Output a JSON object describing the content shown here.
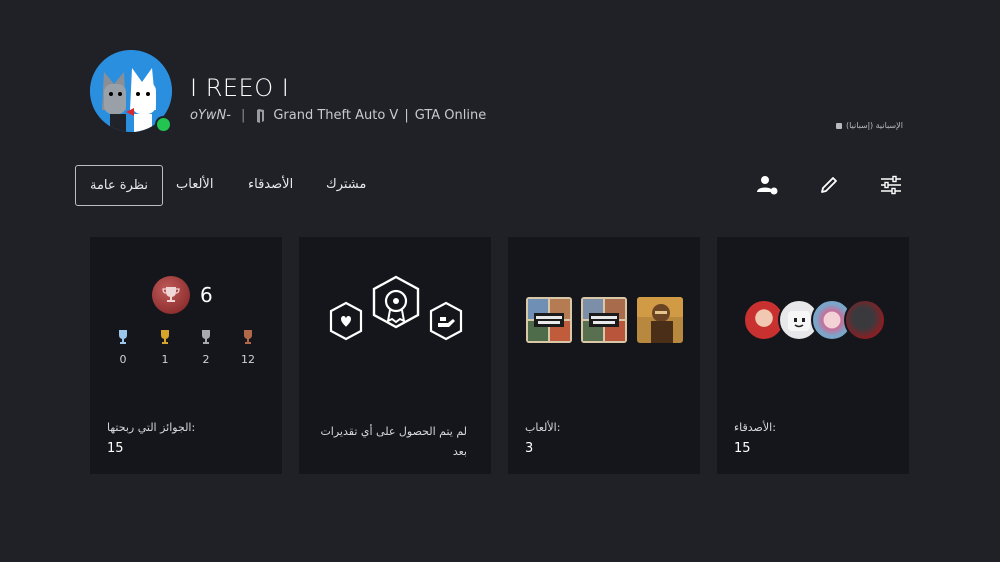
{
  "profile": {
    "name": "I REEO I",
    "online_id": "oYwN-",
    "separator": "|",
    "activity": "Grand Theft Auto V",
    "activity_separator": "|",
    "activity_detail": "GTA Online",
    "language": "الإسبانية (إسبانيا)",
    "online_status_color": "#23c552"
  },
  "tabs": {
    "overview": "نظرة عامة",
    "games": "الألعاب",
    "friends": "الأصدقاء",
    "subscriptions": "مشترك"
  },
  "toolbar": {
    "icons": [
      "add-friend-icon",
      "edit-icon",
      "settings-sliders-icon"
    ]
  },
  "cards": {
    "trophies": {
      "level": "6",
      "platinum": "0",
      "gold": "1",
      "silver": "2",
      "bronze": "12",
      "label": "الجوائز التي ربحتها:",
      "value": "15"
    },
    "awards": {
      "label": "لم يتم الحصول على أي تقديرات بعد"
    },
    "games": {
      "label": "الألعاب:",
      "value": "3"
    },
    "friends": {
      "label": "الأصدقاء:",
      "value": "15"
    }
  }
}
